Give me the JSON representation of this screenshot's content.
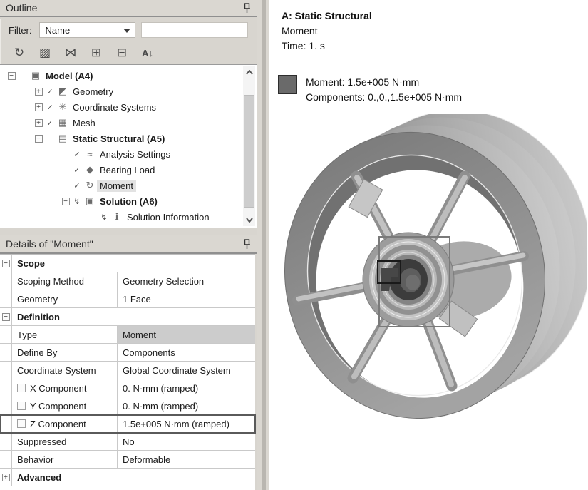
{
  "outline": {
    "title": "Outline",
    "pin_icon": "pin-icon",
    "filter_label": "Filter:",
    "filter_value": "Name",
    "search_value": "",
    "toolbar": [
      {
        "name": "refresh-worksheet-icon",
        "glyph": "↻"
      },
      {
        "name": "graphics-icon",
        "glyph": "▨"
      },
      {
        "name": "show-vertices-icon",
        "glyph": "⋈"
      },
      {
        "name": "expand-all-icon",
        "glyph": "⊞"
      },
      {
        "name": "collapse-icon",
        "glyph": "⊟"
      },
      {
        "name": "sort-az-icon",
        "glyph": "A↓"
      }
    ],
    "tree": [
      {
        "label": "Model (A4)",
        "expander": "−",
        "marker": "",
        "icon_glyph": "▣",
        "icon": "model-icon"
      },
      {
        "label": "Geometry",
        "expander": "+",
        "marker": "✓",
        "icon_glyph": "◩",
        "icon": "geometry-icon"
      },
      {
        "label": "Coordinate Systems",
        "expander": "+",
        "marker": "✓",
        "icon_glyph": "✳",
        "icon": "coordinate-systems-icon"
      },
      {
        "label": "Mesh",
        "expander": "+",
        "marker": "✓",
        "icon_glyph": "▦",
        "icon": "mesh-icon"
      },
      {
        "label": "Static Structural (A5)",
        "expander": "−",
        "marker": "",
        "icon_glyph": "▤",
        "icon": "static-structural-icon"
      },
      {
        "label": "Analysis Settings",
        "expander": "",
        "marker": "✓",
        "icon_glyph": "≈",
        "icon": "analysis-settings-icon"
      },
      {
        "label": "Bearing Load",
        "expander": "",
        "marker": "✓",
        "icon_glyph": "◆",
        "icon": "bearing-load-icon"
      },
      {
        "label": "Moment",
        "expander": "",
        "marker": "✓",
        "icon_glyph": "↻",
        "icon": "moment-icon"
      },
      {
        "label": "Solution (A6)",
        "expander": "−",
        "marker": "↯",
        "icon_glyph": "▣",
        "icon": "solution-icon"
      },
      {
        "label": "Solution Information",
        "expander": "",
        "marker": "↯",
        "icon_glyph": "ℹ",
        "icon": "solution-information-icon"
      }
    ]
  },
  "details": {
    "title": "Details of \"Moment\"",
    "rows": [
      {
        "type": "group",
        "label": "Scope",
        "expander": "−"
      },
      {
        "type": "prop",
        "label": "Scoping Method",
        "value": "Geometry Selection"
      },
      {
        "type": "prop",
        "label": "Geometry",
        "value": "1 Face"
      },
      {
        "type": "group",
        "label": "Definition",
        "expander": "−"
      },
      {
        "type": "prop",
        "label": "Type",
        "value": "Moment"
      },
      {
        "type": "prop",
        "label": "Define By",
        "value": "Components"
      },
      {
        "type": "prop",
        "label": "Coordinate System",
        "value": "Global Coordinate System"
      },
      {
        "type": "prop",
        "label": "X Component",
        "value": "0. N·mm  (ramped)"
      },
      {
        "type": "prop",
        "label": "Y Component",
        "value": "0. N·mm  (ramped)"
      },
      {
        "type": "prop",
        "label": "Z Component",
        "value": "1.5e+005 N·mm  (ramped)"
      },
      {
        "type": "prop",
        "label": "Suppressed",
        "value": "No"
      },
      {
        "type": "prop",
        "label": "Behavior",
        "value": "Deformable"
      },
      {
        "type": "group",
        "label": "Advanced",
        "expander": "+"
      }
    ]
  },
  "viewport": {
    "annotation": {
      "line1": "A: Static Structural",
      "line2": "Moment",
      "line3": "Time: 1. s"
    },
    "legend": {
      "swatch_color": "#6a6a6a",
      "line1": "Moment: 1.5e+005 N·mm",
      "line2": "Components: 0.,0.,1.5e+005 N·mm"
    }
  }
}
